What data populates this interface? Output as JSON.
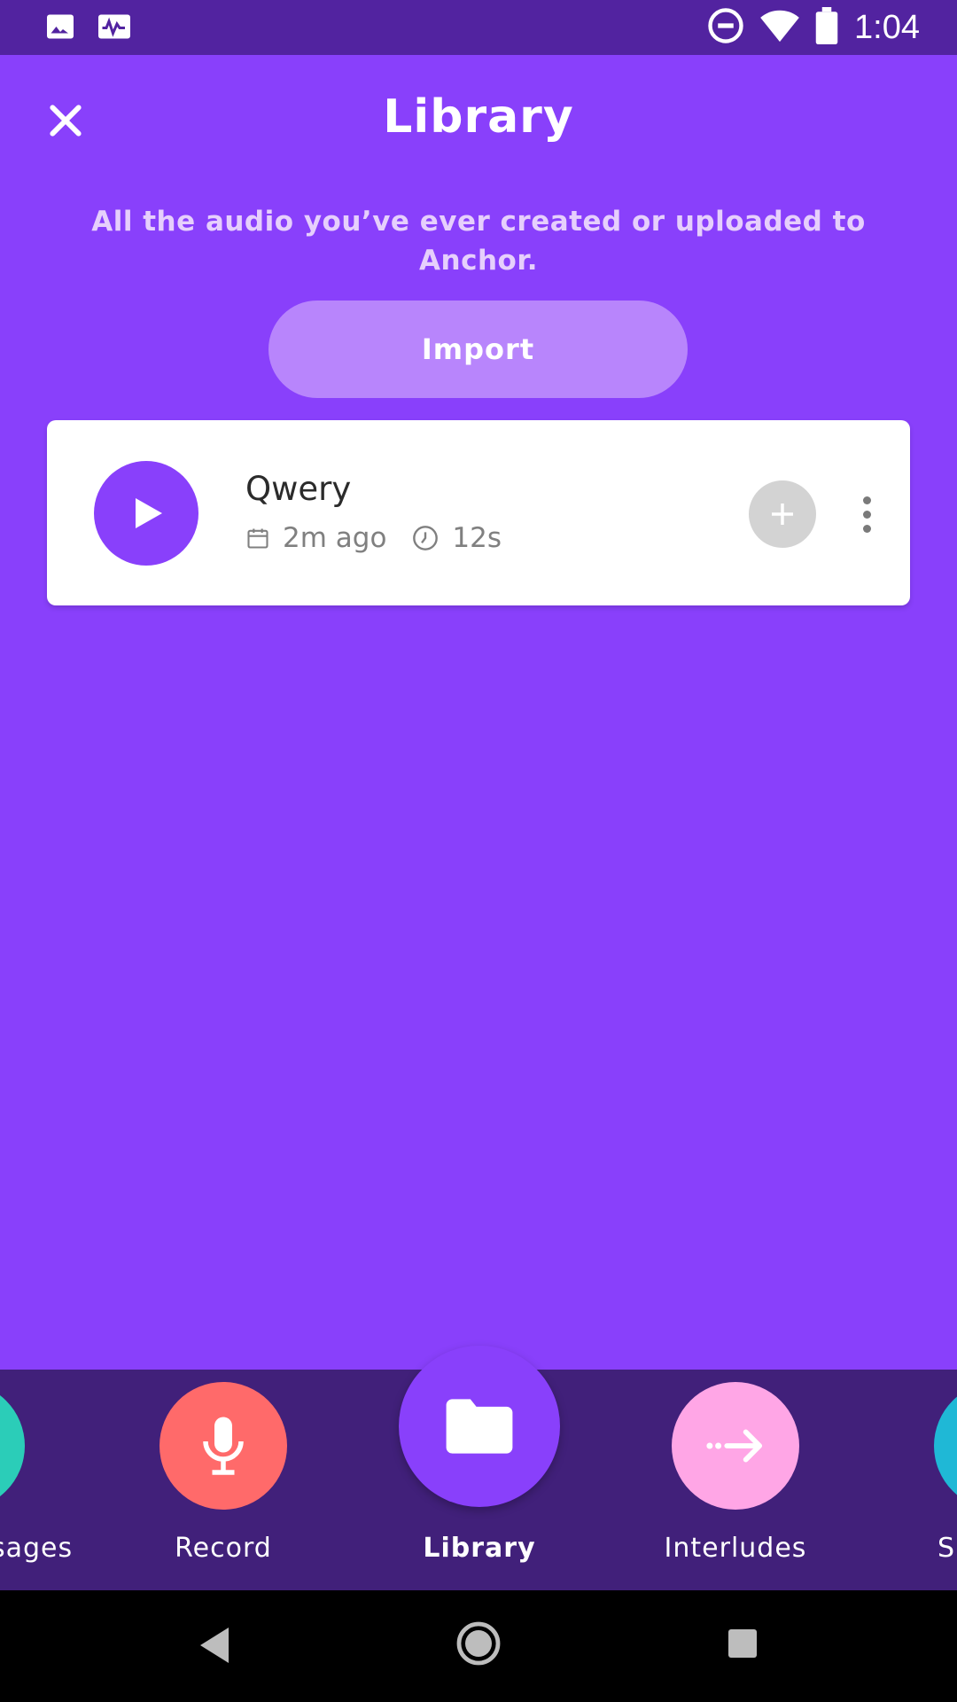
{
  "status_bar": {
    "time": "1:04",
    "icons": [
      "image-icon",
      "activity-icon",
      "do-not-disturb-icon",
      "wifi-icon",
      "battery-icon"
    ]
  },
  "header": {
    "title": "Library",
    "close_icon": "close-icon"
  },
  "library": {
    "description": "All the audio you’ve ever created or uploaded to Anchor.",
    "import_label": "Import"
  },
  "audio_items": [
    {
      "title": "Qwery",
      "date": "2m ago",
      "duration": "12s"
    }
  ],
  "bottom_nav": {
    "items": [
      {
        "label": "sages",
        "color": "#2bcdb8"
      },
      {
        "label": "Record",
        "color": "#ff6a6a"
      },
      {
        "label": "Library",
        "color": "#8940fb",
        "active": true
      },
      {
        "label": "Interludes",
        "color": "#ffa6e6"
      },
      {
        "label": "S",
        "color": "#1fb8d6"
      }
    ]
  },
  "colors": {
    "primary": "#8940fb",
    "status_bar": "#5223a0",
    "nav_bar": "#41207a",
    "import_button": "#b885fc"
  }
}
